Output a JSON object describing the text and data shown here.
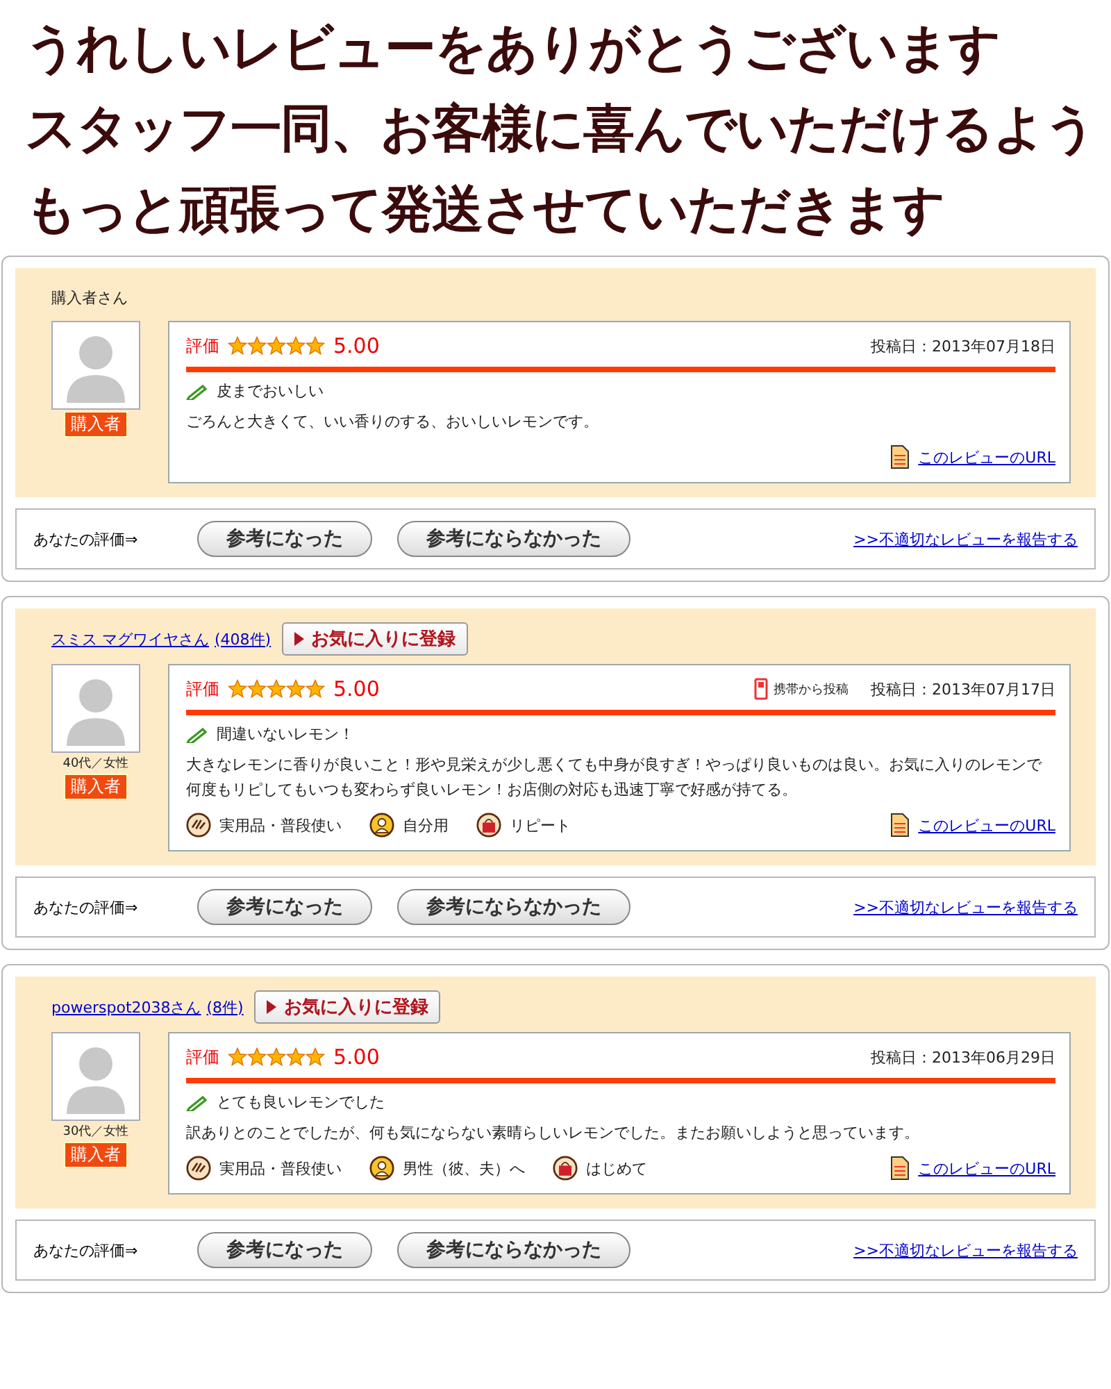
{
  "headline": [
    "うれしいレビューをありがとうございます",
    "スタッフ一同、お客様に喜んでいただけるよう",
    "もっと頑張って発送させていただきます"
  ],
  "reviews": [
    {
      "reviewer": {
        "name": "購入者さん",
        "linked": false
      },
      "badge": "購入者",
      "rating_label": "評価",
      "stars": 5,
      "score": "5.00",
      "date": "投稿日：2013年07月18日",
      "title": "皮までおいしい",
      "body": "ごろんと大きくて、いい香りのする、おいしいレモンです。",
      "url_link": "このレビューのURL",
      "footer": {
        "label": "あなたの評価⇒",
        "buttons": [
          "参考になった",
          "参考にならなかった"
        ],
        "report": ">>不適切なレビューを報告する"
      }
    },
    {
      "reviewer": {
        "name": "スミス マグワイヤさん",
        "linked": true,
        "count": "(408件)",
        "favorite": "お気に入りに登録"
      },
      "demographic": "40代／女性",
      "badge": "購入者",
      "rating_label": "評価",
      "stars": 5,
      "score": "5.00",
      "mobile": "携帯から投稿",
      "date": "投稿日：2013年07月17日",
      "title": "間違いないレモン！",
      "body": "大きなレモンに香りが良いこと！形や見栄えが少し悪くても中身が良すぎ！やっぱり良いものは良い。お気に入りのレモンで何度もリピしてもいつも変わらず良いレモン！お店側の対応も迅速丁寧で好感が持てる。",
      "tags": [
        {
          "kind": "hand",
          "text": "実用品・普段使い"
        },
        {
          "kind": "person",
          "text": "自分用"
        },
        {
          "kind": "bag",
          "text": "リピート"
        }
      ],
      "url_link": "このレビューのURL",
      "footer": {
        "label": "あなたの評価⇒",
        "buttons": [
          "参考になった",
          "参考にならなかった"
        ],
        "report": ">>不適切なレビューを報告する"
      }
    },
    {
      "reviewer": {
        "name": "powerspot2038さん",
        "linked": true,
        "count": "(8件)",
        "favorite": "お気に入りに登録"
      },
      "demographic": "30代／女性",
      "badge": "購入者",
      "rating_label": "評価",
      "stars": 5,
      "score": "5.00",
      "date": "投稿日：2013年06月29日",
      "title": "とても良いレモンでした",
      "body": "訳ありとのことでしたが、何も気にならない素晴らしいレモンでした。またお願いしようと思っています。",
      "tags": [
        {
          "kind": "hand",
          "text": "実用品・普段使い"
        },
        {
          "kind": "person",
          "text": "男性（彼、夫）へ"
        },
        {
          "kind": "bag",
          "text": "はじめて"
        }
      ],
      "url_link": "このレビューのURL",
      "footer": {
        "label": "あなたの評価⇒",
        "buttons": [
          "参考になった",
          "参考にならなかった"
        ],
        "report": ">>不適切なレビューを報告する"
      }
    }
  ]
}
